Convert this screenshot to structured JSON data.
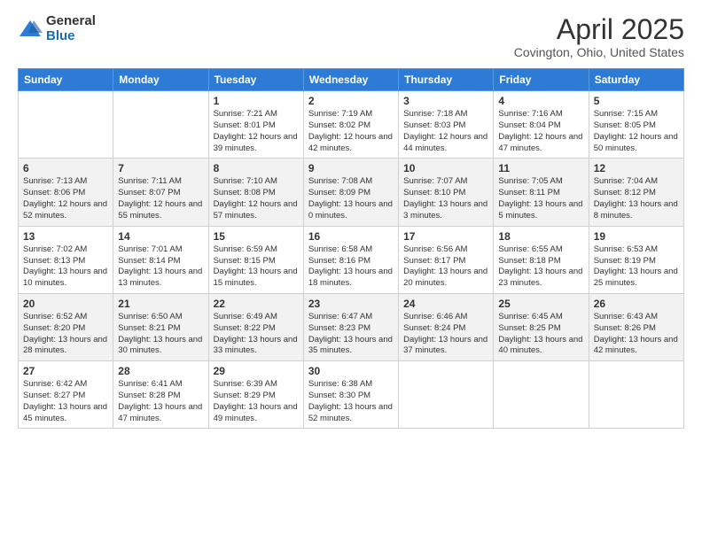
{
  "header": {
    "logo": {
      "general": "General",
      "blue": "Blue"
    },
    "title": "April 2025",
    "subtitle": "Covington, Ohio, United States"
  },
  "calendar": {
    "days_of_week": [
      "Sunday",
      "Monday",
      "Tuesday",
      "Wednesday",
      "Thursday",
      "Friday",
      "Saturday"
    ],
    "weeks": [
      [
        {
          "day": "",
          "info": ""
        },
        {
          "day": "",
          "info": ""
        },
        {
          "day": "1",
          "info": "Sunrise: 7:21 AM\nSunset: 8:01 PM\nDaylight: 12 hours and 39 minutes."
        },
        {
          "day": "2",
          "info": "Sunrise: 7:19 AM\nSunset: 8:02 PM\nDaylight: 12 hours and 42 minutes."
        },
        {
          "day": "3",
          "info": "Sunrise: 7:18 AM\nSunset: 8:03 PM\nDaylight: 12 hours and 44 minutes."
        },
        {
          "day": "4",
          "info": "Sunrise: 7:16 AM\nSunset: 8:04 PM\nDaylight: 12 hours and 47 minutes."
        },
        {
          "day": "5",
          "info": "Sunrise: 7:15 AM\nSunset: 8:05 PM\nDaylight: 12 hours and 50 minutes."
        }
      ],
      [
        {
          "day": "6",
          "info": "Sunrise: 7:13 AM\nSunset: 8:06 PM\nDaylight: 12 hours and 52 minutes."
        },
        {
          "day": "7",
          "info": "Sunrise: 7:11 AM\nSunset: 8:07 PM\nDaylight: 12 hours and 55 minutes."
        },
        {
          "day": "8",
          "info": "Sunrise: 7:10 AM\nSunset: 8:08 PM\nDaylight: 12 hours and 57 minutes."
        },
        {
          "day": "9",
          "info": "Sunrise: 7:08 AM\nSunset: 8:09 PM\nDaylight: 13 hours and 0 minutes."
        },
        {
          "day": "10",
          "info": "Sunrise: 7:07 AM\nSunset: 8:10 PM\nDaylight: 13 hours and 3 minutes."
        },
        {
          "day": "11",
          "info": "Sunrise: 7:05 AM\nSunset: 8:11 PM\nDaylight: 13 hours and 5 minutes."
        },
        {
          "day": "12",
          "info": "Sunrise: 7:04 AM\nSunset: 8:12 PM\nDaylight: 13 hours and 8 minutes."
        }
      ],
      [
        {
          "day": "13",
          "info": "Sunrise: 7:02 AM\nSunset: 8:13 PM\nDaylight: 13 hours and 10 minutes."
        },
        {
          "day": "14",
          "info": "Sunrise: 7:01 AM\nSunset: 8:14 PM\nDaylight: 13 hours and 13 minutes."
        },
        {
          "day": "15",
          "info": "Sunrise: 6:59 AM\nSunset: 8:15 PM\nDaylight: 13 hours and 15 minutes."
        },
        {
          "day": "16",
          "info": "Sunrise: 6:58 AM\nSunset: 8:16 PM\nDaylight: 13 hours and 18 minutes."
        },
        {
          "day": "17",
          "info": "Sunrise: 6:56 AM\nSunset: 8:17 PM\nDaylight: 13 hours and 20 minutes."
        },
        {
          "day": "18",
          "info": "Sunrise: 6:55 AM\nSunset: 8:18 PM\nDaylight: 13 hours and 23 minutes."
        },
        {
          "day": "19",
          "info": "Sunrise: 6:53 AM\nSunset: 8:19 PM\nDaylight: 13 hours and 25 minutes."
        }
      ],
      [
        {
          "day": "20",
          "info": "Sunrise: 6:52 AM\nSunset: 8:20 PM\nDaylight: 13 hours and 28 minutes."
        },
        {
          "day": "21",
          "info": "Sunrise: 6:50 AM\nSunset: 8:21 PM\nDaylight: 13 hours and 30 minutes."
        },
        {
          "day": "22",
          "info": "Sunrise: 6:49 AM\nSunset: 8:22 PM\nDaylight: 13 hours and 33 minutes."
        },
        {
          "day": "23",
          "info": "Sunrise: 6:47 AM\nSunset: 8:23 PM\nDaylight: 13 hours and 35 minutes."
        },
        {
          "day": "24",
          "info": "Sunrise: 6:46 AM\nSunset: 8:24 PM\nDaylight: 13 hours and 37 minutes."
        },
        {
          "day": "25",
          "info": "Sunrise: 6:45 AM\nSunset: 8:25 PM\nDaylight: 13 hours and 40 minutes."
        },
        {
          "day": "26",
          "info": "Sunrise: 6:43 AM\nSunset: 8:26 PM\nDaylight: 13 hours and 42 minutes."
        }
      ],
      [
        {
          "day": "27",
          "info": "Sunrise: 6:42 AM\nSunset: 8:27 PM\nDaylight: 13 hours and 45 minutes."
        },
        {
          "day": "28",
          "info": "Sunrise: 6:41 AM\nSunset: 8:28 PM\nDaylight: 13 hours and 47 minutes."
        },
        {
          "day": "29",
          "info": "Sunrise: 6:39 AM\nSunset: 8:29 PM\nDaylight: 13 hours and 49 minutes."
        },
        {
          "day": "30",
          "info": "Sunrise: 6:38 AM\nSunset: 8:30 PM\nDaylight: 13 hours and 52 minutes."
        },
        {
          "day": "",
          "info": ""
        },
        {
          "day": "",
          "info": ""
        },
        {
          "day": "",
          "info": ""
        }
      ]
    ]
  }
}
